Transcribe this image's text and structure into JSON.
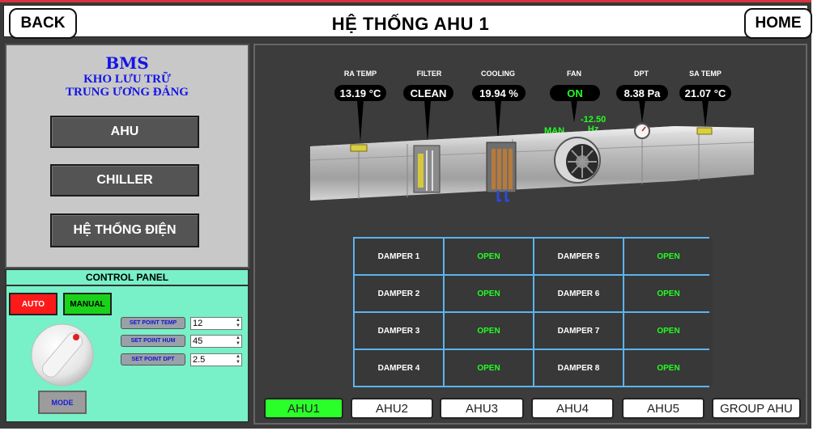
{
  "header": {
    "back_label": "BACK",
    "title": "HỆ THỐNG AHU 1",
    "home_label": "HOME"
  },
  "sidebar": {
    "title": "BMS",
    "subtitle_line1": "KHO LƯU TRỮ",
    "subtitle_line2": "TRUNG ƯƠNG ĐẢNG",
    "nav": [
      {
        "label": "AHU"
      },
      {
        "label": "CHILLER"
      },
      {
        "label": "HỆ THỐNG ĐIỆN"
      }
    ]
  },
  "control_panel": {
    "title": "CONTROL PANEL",
    "auto_label": "AUTO",
    "manual_label": "MANUAL",
    "mode_label": "MODE",
    "setpoints": [
      {
        "label": "SET POINT TEMP",
        "value": "12"
      },
      {
        "label": "SET POINT HUM",
        "value": "45"
      },
      {
        "label": "SET POINT DPT",
        "value": "2.5"
      }
    ],
    "colors": {
      "auto": "#ff1a1a",
      "manual": "#1ad21a"
    }
  },
  "sensors": [
    {
      "label": "RA TEMP",
      "value": "13.19 °C"
    },
    {
      "label": "FILTER",
      "value": "CLEAN"
    },
    {
      "label": "COOLING",
      "value": "19.94 %"
    },
    {
      "label": "FAN",
      "value": "ON"
    },
    {
      "label": "DPT",
      "value": "8.38  Pa"
    },
    {
      "label": "SA TEMP",
      "value": "21.07 °C"
    }
  ],
  "fan": {
    "mode": "MAN",
    "frequency": "-12.50",
    "frequency_unit": "Hz"
  },
  "dampers": [
    {
      "name": "DAMPER 1",
      "state": "OPEN"
    },
    {
      "name": "DAMPER 2",
      "state": "OPEN"
    },
    {
      "name": "DAMPER 3",
      "state": "OPEN"
    },
    {
      "name": "DAMPER 4",
      "state": "OPEN"
    },
    {
      "name": "DAMPER 5",
      "state": "OPEN"
    },
    {
      "name": "DAMPER 6",
      "state": "OPEN"
    },
    {
      "name": "DAMPER 7",
      "state": "OPEN"
    },
    {
      "name": "DAMPER 8",
      "state": "OPEN"
    }
  ],
  "ahu_tabs": [
    {
      "label": "AHU1",
      "active": true
    },
    {
      "label": "AHU2"
    },
    {
      "label": "AHU3"
    },
    {
      "label": "AHU4"
    },
    {
      "label": "AHU5"
    },
    {
      "label": "GROUP AHU"
    }
  ],
  "colors": {
    "status_green": "#22ff22",
    "grid_border": "#5bb4f0",
    "control_panel_bg": "#78f0c8",
    "title_blue": "#1414e6"
  }
}
